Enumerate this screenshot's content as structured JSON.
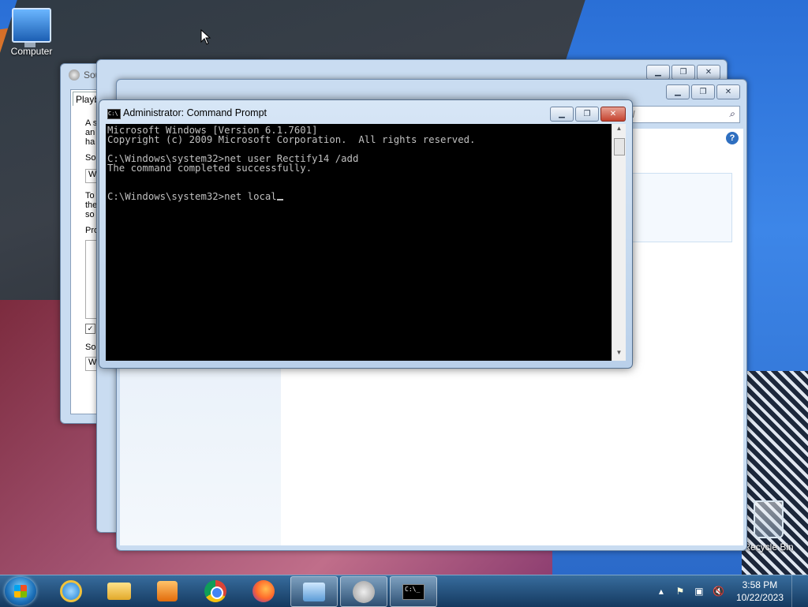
{
  "desktop": {
    "icons": [
      {
        "label": "Computer",
        "icon": "computer-icon"
      },
      {
        "label": "Recycle Bin",
        "icon": "recycle-bin-icon"
      }
    ]
  },
  "sound_window": {
    "title": "Sou",
    "tab": "Playb",
    "text_fragments": [
      "A s",
      "an",
      "ha",
      "So",
      "W",
      "To",
      "the",
      "so",
      "Pro",
      "So",
      "W"
    ]
  },
  "control_panel_window": {
    "search_placeholder": "el",
    "fragment": "1"
  },
  "cmd": {
    "title": "Administrator: Command Prompt",
    "lines": [
      "Microsoft Windows [Version 6.1.7601]",
      "Copyright (c) 2009 Microsoft Corporation.  All rights reserved.",
      "",
      "C:\\Windows\\system32>net user Rectify14 /add",
      "The command completed successfully.",
      "",
      "",
      "C:\\Windows\\system32>net local"
    ],
    "icon_text": "C:\\"
  },
  "taskbar": {
    "apps": [
      {
        "name": "internet-explorer"
      },
      {
        "name": "file-explorer"
      },
      {
        "name": "media-player"
      },
      {
        "name": "chrome"
      },
      {
        "name": "firefox"
      },
      {
        "name": "control-panel"
      },
      {
        "name": "sound"
      },
      {
        "name": "command-prompt"
      }
    ],
    "clock": {
      "time": "3:58 PM",
      "date": "10/22/2023"
    }
  }
}
